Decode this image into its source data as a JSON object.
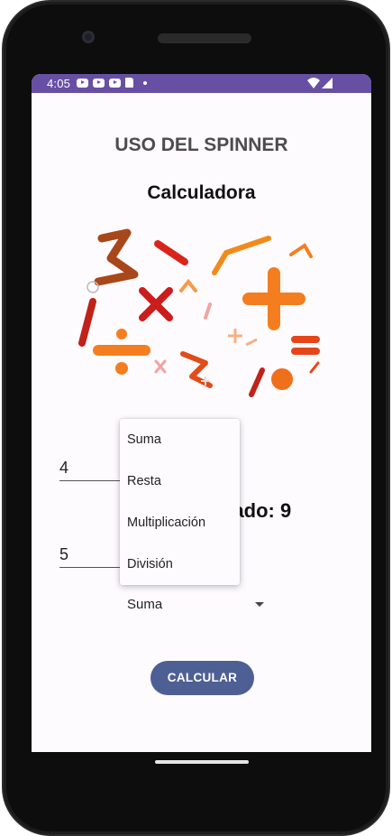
{
  "status_bar": {
    "time": "4:05",
    "bar_color": "#6750a4",
    "notification_icons": [
      "youtube-icon",
      "youtube-icon",
      "youtube-icon",
      "sd-card-icon",
      "dot-icon"
    ],
    "system_icons": [
      "wifi-icon",
      "signal-icon"
    ]
  },
  "app": {
    "title": "USO DEL SPINNER",
    "subtitle": "Calculadora",
    "image_icon": "math-symbols-illustration"
  },
  "inputs": {
    "first_value": "4",
    "second_value": "5"
  },
  "result": {
    "text": "Resultado: 9",
    "visible_text": "ltado: 9"
  },
  "spinner": {
    "selected": "Suma",
    "options": [
      "Suma",
      "Resta",
      "Multiplicación",
      "División"
    ]
  },
  "actions": {
    "calculate_label": "CALCULAR",
    "button_color": "#4e5f94"
  }
}
